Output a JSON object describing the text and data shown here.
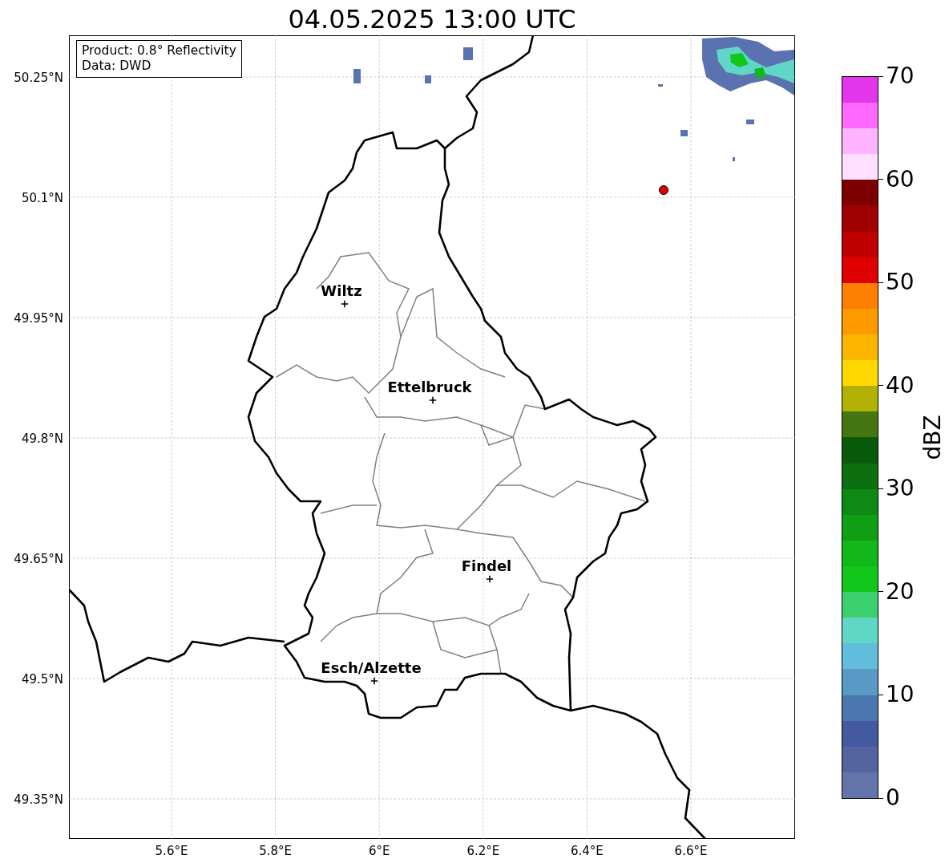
{
  "title": "04.05.2025 13:00 UTC",
  "legend": [
    "Product: 0.8° Reflectivity",
    "Data: DWD"
  ],
  "map": {
    "lat_labels": [
      "50.25°N",
      "50.1°N",
      "49.95°N",
      "49.8°N",
      "49.65°N",
      "49.5°N",
      "49.35°N"
    ],
    "lon_labels": [
      "5.6°E",
      "5.8°E",
      "6°E",
      "6.2°E",
      "6.4°E",
      "6.6°E"
    ],
    "cities": [
      {
        "name": "Wiltz"
      },
      {
        "name": "Ettelbruck"
      },
      {
        "name": "Findel"
      },
      {
        "name": "Esch/Alzette"
      }
    ]
  },
  "colorbar": {
    "label": "dBZ",
    "ticks": [
      "70",
      "60",
      "50",
      "40",
      "30",
      "20",
      "10",
      "0"
    ],
    "bands": [
      {
        "color": "#6474a8"
      },
      {
        "color": "#53649e"
      },
      {
        "color": "#44599f"
      },
      {
        "color": "#4a77b0"
      },
      {
        "color": "#5899c5"
      },
      {
        "color": "#62bcdc"
      },
      {
        "color": "#5fd6c6"
      },
      {
        "color": "#3ccf6e"
      },
      {
        "color": "#12c61b"
      },
      {
        "color": "#12b71a"
      },
      {
        "color": "#109f14"
      },
      {
        "color": "#0e8a14"
      },
      {
        "color": "#0c7010"
      },
      {
        "color": "#0a5a0c"
      },
      {
        "color": "#467611"
      },
      {
        "color": "#b1b106"
      },
      {
        "color": "#fed800"
      },
      {
        "color": "#feb500"
      },
      {
        "color": "#fe9a00"
      },
      {
        "color": "#fe7e00"
      },
      {
        "color": "#e10000"
      },
      {
        "color": "#c00000"
      },
      {
        "color": "#9f0000"
      },
      {
        "color": "#7d0000"
      },
      {
        "color": "#ffdeff"
      },
      {
        "color": "#ffb4ff"
      },
      {
        "color": "#ff68ff"
      },
      {
        "color": "#e436ed"
      }
    ]
  }
}
